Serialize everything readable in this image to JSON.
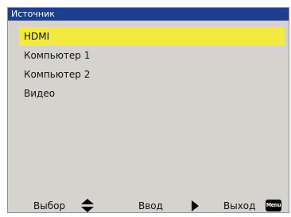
{
  "window": {
    "title": "Источник"
  },
  "source_list": {
    "selected_index": 0,
    "items": [
      {
        "label": "HDMI"
      },
      {
        "label": "Компьютер 1"
      },
      {
        "label": "Компьютер 2"
      },
      {
        "label": "Видео"
      }
    ]
  },
  "footer": {
    "select_label": "Выбор",
    "select_icon": "up-down-arrows-icon",
    "enter_label": "Ввод",
    "enter_icon": "right-arrow-icon",
    "exit_label": "Выход",
    "exit_key_label": "Menu"
  },
  "colors": {
    "title_bar": "#1e3f8e",
    "panel": "#d4d3ce",
    "highlight": "#f2eb3e"
  }
}
